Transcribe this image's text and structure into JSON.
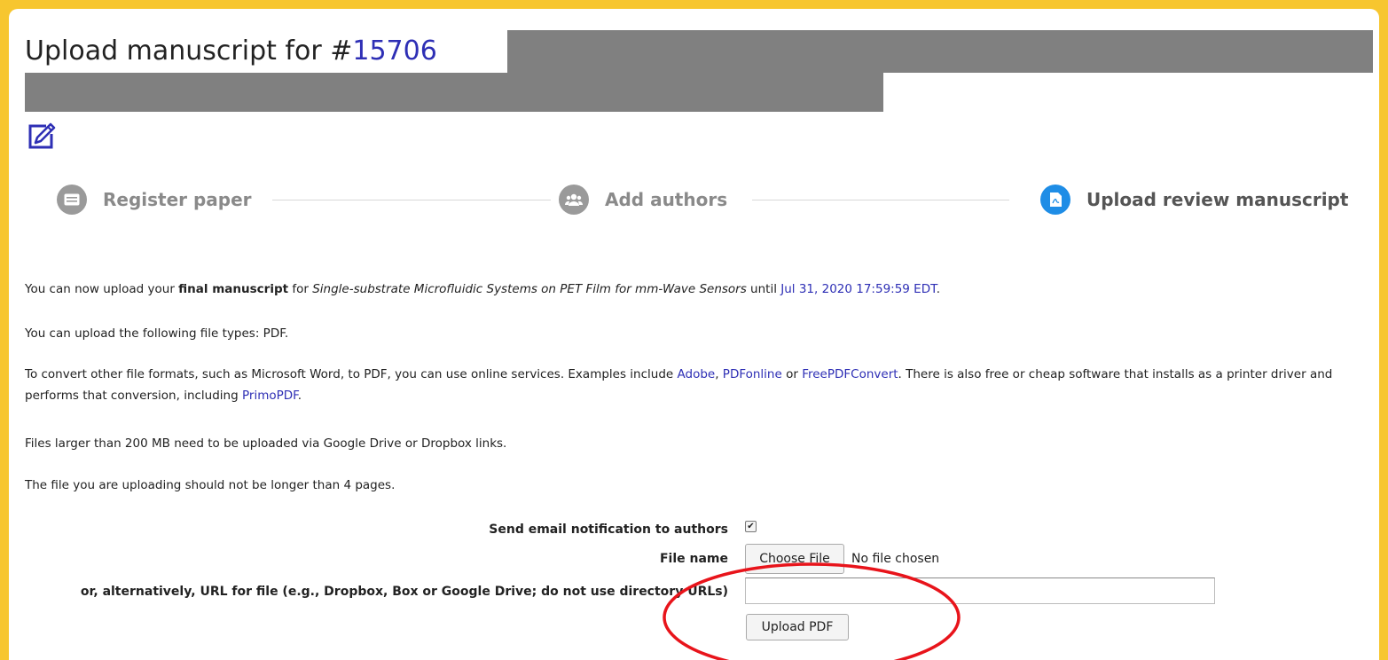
{
  "header": {
    "title_prefix": "Upload manuscript for #",
    "paper_id": "15706"
  },
  "steps": [
    {
      "label": "Register paper",
      "icon": "card-icon",
      "state": "done"
    },
    {
      "label": "Add authors",
      "icon": "users-icon",
      "state": "done"
    },
    {
      "label": "Upload review manuscript",
      "icon": "pdf-icon",
      "state": "active"
    }
  ],
  "info": {
    "p1_before": "You can now upload your ",
    "p1_bold": "final manuscript",
    "p1_for": " for ",
    "p1_title": "Single-substrate Microfluidic Systems on PET Film for mm-Wave Sensors",
    "p1_until": " until ",
    "p1_deadline": "Jul 31, 2020 17:59:59 EDT",
    "p1_end": ".",
    "p2": "You can upload the following file types: PDF.",
    "p3_a": "To convert other file formats, such as Microsoft Word, to PDF, you can use online services. Examples include ",
    "p3_link1": "Adobe",
    "p3_sep1": ", ",
    "p3_link2": "PDFonline",
    "p3_sep2": " or ",
    "p3_link3": "FreePDFConvert",
    "p3_b": ". There is also free or cheap software that installs as a printer driver and performs that conversion, including ",
    "p3_link4": "PrimoPDF",
    "p3_end": ".",
    "p4": "Files larger than 200 MB need to be uploaded via Google Drive or Dropbox links.",
    "p5": "The file you are uploading should not be longer than 4 pages."
  },
  "form": {
    "email_label": "Send email notification to authors",
    "email_checked": true,
    "checkmark": "✔",
    "file_label": "File name",
    "choose_file": "Choose File",
    "no_file": "No file chosen",
    "url_label": "or, alternatively, URL for file (e.g., Dropbox, Box or Google Drive; do not use directory URLs)",
    "url_value": "",
    "upload_button": "Upload PDF"
  },
  "colors": {
    "frame": "#f7c62f",
    "link": "#2e2fb5",
    "step_active": "#1e8de6",
    "step_inactive": "#9a9a9a",
    "annotation": "#e8141b",
    "redaction": "#808080"
  }
}
